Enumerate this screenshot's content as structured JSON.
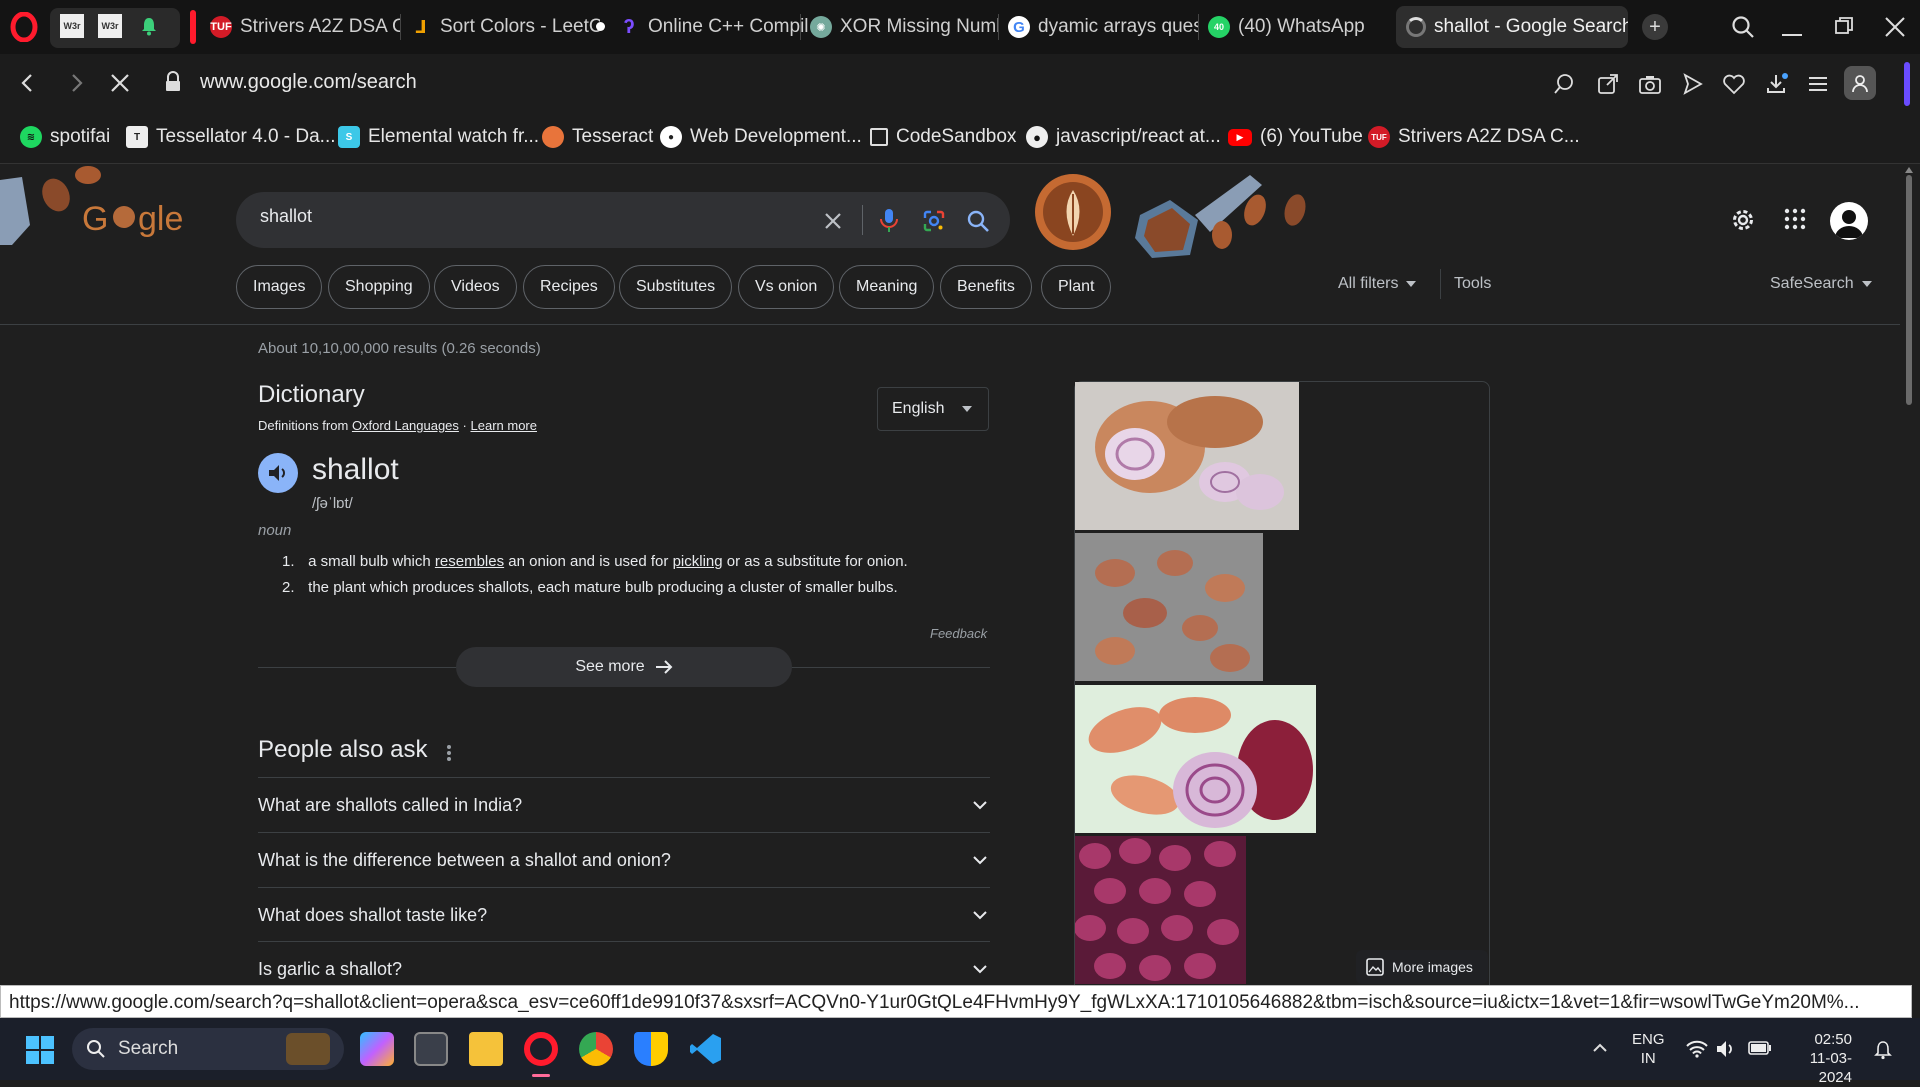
{
  "tabs": [
    {
      "label": "W3r",
      "favicon": "w3r"
    },
    {
      "label": "W3r",
      "favicon": "w3r"
    },
    {
      "label": "Strivers A2Z DSA Co",
      "favicon": "tuf"
    },
    {
      "label": "Sort Colors - LeetCo",
      "favicon": "leetcode"
    },
    {
      "label": "Online C++ Compile",
      "favicon": "compiler"
    },
    {
      "label": "XOR Missing Numb",
      "favicon": "chatgpt"
    },
    {
      "label": "dyamic arrays ques",
      "favicon": "google"
    },
    {
      "label": "(40) WhatsApp",
      "favicon": "whatsapp"
    },
    {
      "label": "shallot - Google Search",
      "favicon": "loading"
    }
  ],
  "address": {
    "url": "www.google.com/search"
  },
  "bookmarks": [
    {
      "label": "spotifai",
      "icon": "spotify-icon"
    },
    {
      "label": "Tessellator 4.0 - Da...",
      "icon": "tessellator-icon"
    },
    {
      "label": "Elemental watch fr...",
      "icon": "elemental-icon"
    },
    {
      "label": "Tesseract",
      "icon": "tesseract-icon"
    },
    {
      "label": "Web Development...",
      "icon": "webdev-icon"
    },
    {
      "label": "CodeSandbox",
      "icon": "codesandbox-icon"
    },
    {
      "label": "javascript/react at...",
      "icon": "github-icon"
    },
    {
      "label": "(6) YouTube",
      "icon": "youtube-icon"
    },
    {
      "label": "Strivers A2Z DSA C...",
      "icon": "tuf-icon"
    }
  ],
  "search": {
    "query": "shallot"
  },
  "chips": [
    "Images",
    "Shopping",
    "Videos",
    "Recipes",
    "Substitutes",
    "Vs onion",
    "Meaning",
    "Benefits",
    "Plant"
  ],
  "filters": {
    "all_filters": "All filters",
    "tools": "Tools",
    "safesearch": "SafeSearch"
  },
  "results_stats": "About 10,10,00,000 results (0.26 seconds)",
  "dictionary": {
    "heading": "Dictionary",
    "source_prefix": "Definitions from",
    "source": "Oxford Languages",
    "sep": "·",
    "learn_more": "Learn more",
    "language": "English",
    "word": "shallot",
    "phonetic": "/ʃəˈlɒt/",
    "pos": "noun",
    "definitions": [
      {
        "num": "1.",
        "pre": "a small bulb which ",
        "link1": "resembles",
        "mid": " an onion and is used for ",
        "link2": "pickling",
        "post": " or as a substitute for onion."
      },
      {
        "num": "2.",
        "text": "the plant which produces shallots, each mature bulb producing a cluster of smaller bulbs."
      }
    ],
    "feedback": "Feedback",
    "see_more": "See more"
  },
  "people_also_ask": {
    "heading": "People also ask",
    "questions": [
      "What are shallots called in India?",
      "What is the difference between a shallot and onion?",
      "What does shallot taste like?",
      "Is garlic a shallot?"
    ]
  },
  "images_panel": {
    "more_images": "More images"
  },
  "status_url": "https://www.google.com/search?q=shallot&client=opera&sca_esv=ce60ff1de9910f37&sxsrf=ACQVn0-Y1ur0GtQLe4FHvmHy9Y_fgWLxXA:1710105646882&tbm=isch&source=iu&ictx=1&vet=1&fir=wsowlTwGeYm20M%...",
  "taskbar": {
    "search_label": "Search",
    "lang_top": "ENG",
    "lang_bottom": "IN",
    "time": "02:50",
    "date": "11-03-2024"
  },
  "colors": {
    "accent": "#8ab4f8",
    "chip_border": "#5f6368",
    "opera_red": "#ff1b2d"
  }
}
